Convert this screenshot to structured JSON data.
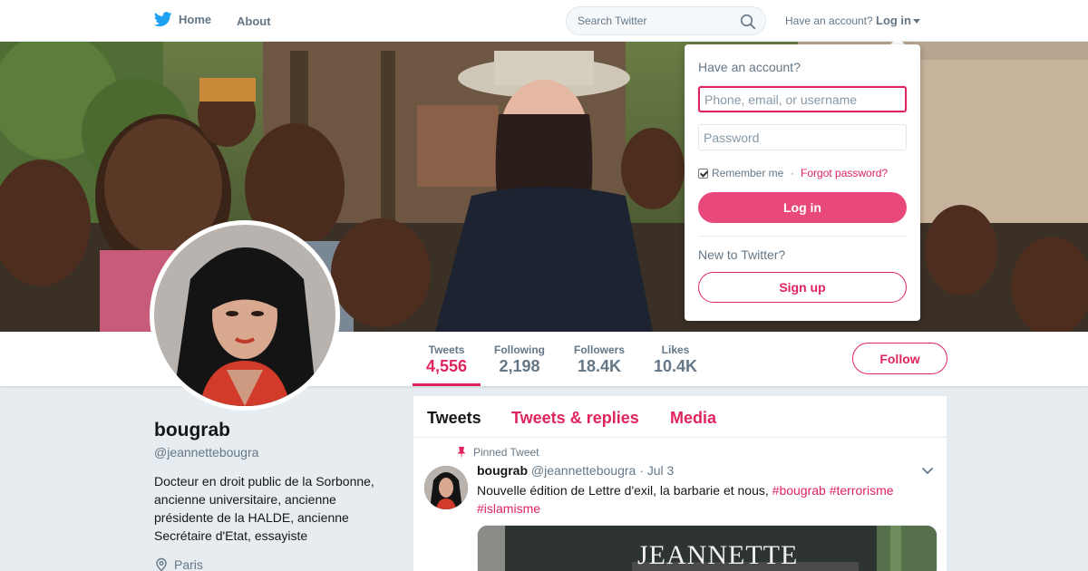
{
  "nav": {
    "home_label": "Home",
    "about_label": "About",
    "search_placeholder": "Search Twitter",
    "have_account": "Have an account?",
    "login_label": "Log in"
  },
  "profile": {
    "name": "bougrab",
    "handle": "@jeannettebougra",
    "bio": "Docteur en droit public de la Sorbonne, ancienne universitaire, ancienne présidente de la HALDE, ancienne Secrétaire d'Etat, essayiste",
    "location": "Paris"
  },
  "stats": [
    {
      "label": "Tweets",
      "value": "4,556"
    },
    {
      "label": "Following",
      "value": "2,198"
    },
    {
      "label": "Followers",
      "value": "18.4K"
    },
    {
      "label": "Likes",
      "value": "10.4K"
    }
  ],
  "follow_label": "Follow",
  "timeline": {
    "tabs": [
      "Tweets",
      "Tweets & replies",
      "Media"
    ],
    "pinned_label": "Pinned Tweet",
    "tweet": {
      "name": "bougrab",
      "handle": "@jeannettebougra",
      "date": "· Jul 3",
      "text": "Nouvelle édition de Lettre d'exil, la barbarie et nous, ",
      "hashtags": [
        "#bougrab",
        "#terrorisme",
        "#islamisme"
      ],
      "media_text": "JEANNETTE"
    }
  },
  "login_dropdown": {
    "title": "Have an account?",
    "username_placeholder": "Phone, email, or username",
    "password_placeholder": "Password",
    "remember_label": "Remember me",
    "separator": " · ",
    "forgot_label": "Forgot password?",
    "login_button": "Log in",
    "new_label": "New to Twitter?",
    "signup_button": "Sign up"
  },
  "colors": {
    "accent": "#e0245e",
    "login_button": "#e8497a",
    "background": "#e6ecf0",
    "twitter_blue": "#1da1f2"
  }
}
